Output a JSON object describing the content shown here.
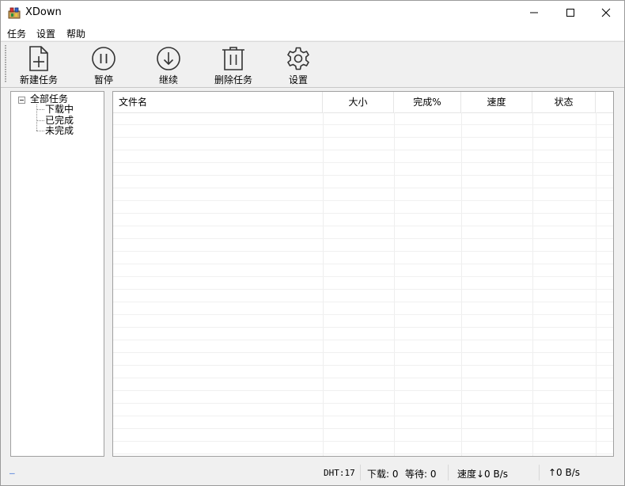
{
  "window": {
    "title": "XDown"
  },
  "menu": {
    "items": [
      "任务",
      "设置",
      "帮助"
    ]
  },
  "toolbar": {
    "buttons": [
      {
        "label": "新建任务",
        "icon": "new-file-plus-icon"
      },
      {
        "label": "暂停",
        "icon": "pause-circle-icon"
      },
      {
        "label": "继续",
        "icon": "download-arrow-circle-icon"
      },
      {
        "label": "删除任务",
        "icon": "trash-icon"
      },
      {
        "label": "设置",
        "icon": "gear-icon"
      }
    ]
  },
  "tree": {
    "root": "全部任务",
    "children": [
      "下载中",
      "已完成",
      "未完成"
    ]
  },
  "table": {
    "columns": [
      "文件名",
      "大小",
      "完成%",
      "速度",
      "状态"
    ],
    "rows": []
  },
  "statusbar": {
    "left_marker": "–",
    "dht": "DHT:17",
    "downloading": "下载: 0",
    "waiting": "等待: 0",
    "speed_down": "速度↓0 B/s",
    "speed_up": "↑0 B/s"
  }
}
